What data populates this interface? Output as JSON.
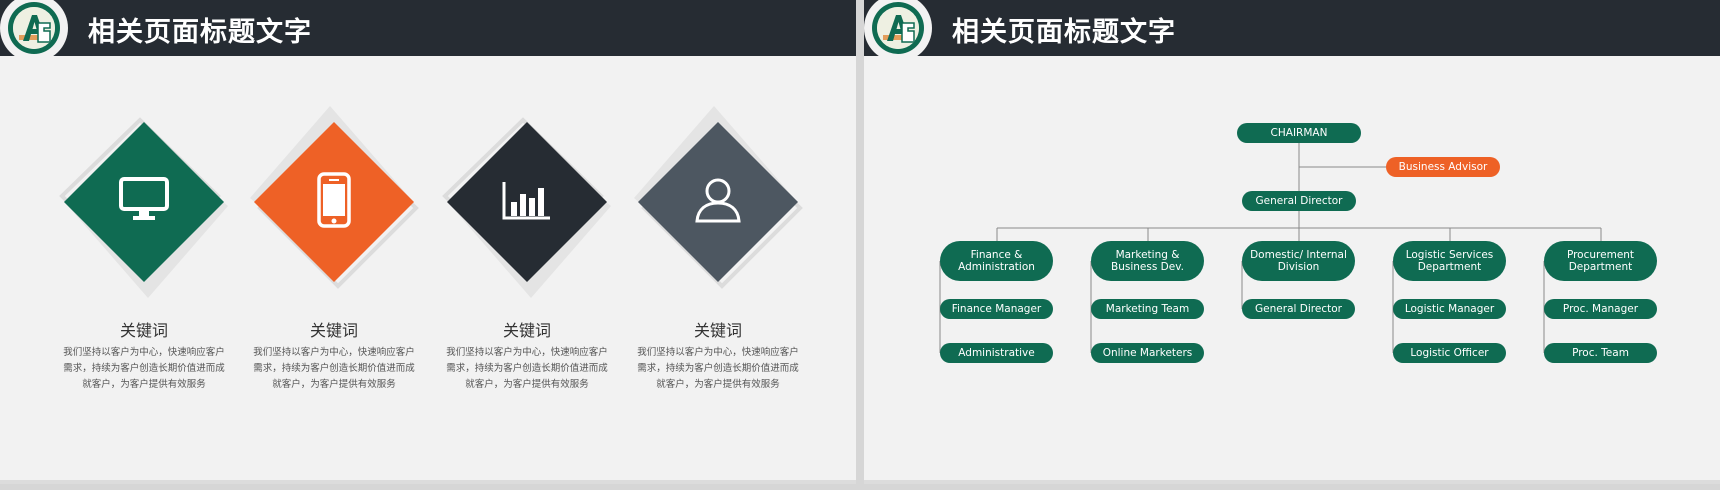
{
  "colors": {
    "green": "#0f6b52",
    "orange": "#ee6126",
    "dark": "#262c33",
    "slate": "#4d5761",
    "background": "#f2f2f2"
  },
  "left_slide": {
    "header_title": "相关页面标题文字",
    "tiles": [
      {
        "icon": "monitor-icon",
        "color": "#0f6b52",
        "keyword": "关键词",
        "description": "我们坚持以客户为中心，快速响应客户需求，持续为客户创造长期价值进而成就客户，为客户提供有效服务"
      },
      {
        "icon": "phone-icon",
        "color": "#ee6126",
        "keyword": "关键词",
        "description": "我们坚持以客户为中心，快速响应客户需求，持续为客户创造长期价值进而成就客户，为客户提供有效服务"
      },
      {
        "icon": "bar-chart-icon",
        "color": "#262c33",
        "keyword": "关键词",
        "description": "我们坚持以客户为中心，快速响应客户需求，持续为客户创造长期价值进而成就客户，为客户提供有效服务"
      },
      {
        "icon": "user-icon",
        "color": "#4d5761",
        "keyword": "关键词",
        "description": "我们坚持以客户为中心，快速响应客户需求，持续为客户创造长期价值进而成就客户，为客户提供有效服务"
      }
    ]
  },
  "right_slide": {
    "header_title": "相关页面标题文字",
    "org": {
      "chairman": "CHAIRMAN",
      "advisor": "Business Advisor",
      "general_director": "General Director",
      "departments": [
        {
          "name": "Finance &\nAdministration",
          "children": [
            "Finance Manager",
            "Administrative"
          ]
        },
        {
          "name": "Marketing &\nBusiness Dev.",
          "children": [
            "Marketing Team",
            "Online Marketers"
          ]
        },
        {
          "name": "Domestic/ Internal\nDivision",
          "children": [
            "General Director"
          ]
        },
        {
          "name": "Logistic Services\nDepartment",
          "children": [
            "Logistic Manager",
            "Logistic Officer"
          ]
        },
        {
          "name": "Procurement\nDepartment",
          "children": [
            "Proc. Manager",
            "Proc. Team"
          ]
        }
      ]
    }
  }
}
